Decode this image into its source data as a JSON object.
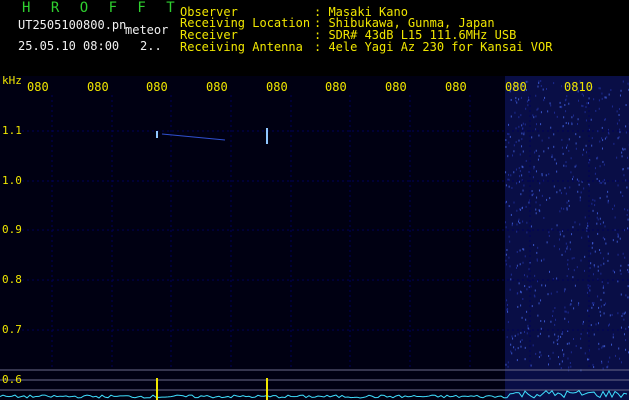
{
  "header": {
    "title": "H R O F F T",
    "filename": "UT2505100800.pn",
    "tag": "meteor",
    "datetime": "25.05.10 08:00",
    "count": "2..",
    "fields": [
      {
        "label": "Observer",
        "value": ": Masaki Kano"
      },
      {
        "label": "Receiving Location",
        "value": ": Shibukawa, Gunma, Japan"
      },
      {
        "label": "Receiver",
        "value": ": SDR# 43dB L15 111.6MHz USB"
      },
      {
        "label": "Receiving Antenna",
        "value": ": 4ele Yagi Az 230 for Kansai VOR"
      }
    ]
  },
  "axes": {
    "unit": "kHz",
    "x_ticks": [
      "080",
      "080",
      "080",
      "080",
      "080",
      "080",
      "080",
      "080",
      "080",
      "0810"
    ],
    "y_ticks": [
      "1.1",
      "1.0",
      "0.9",
      "0.8",
      "0.7",
      "0.6"
    ]
  },
  "colors": {
    "background": "#000010",
    "grid": "#00005a",
    "axis_text": "#f0e600",
    "header_green": "#2fd02f",
    "signal": "#6ab0ff",
    "trace": "#40e0ff"
  }
}
